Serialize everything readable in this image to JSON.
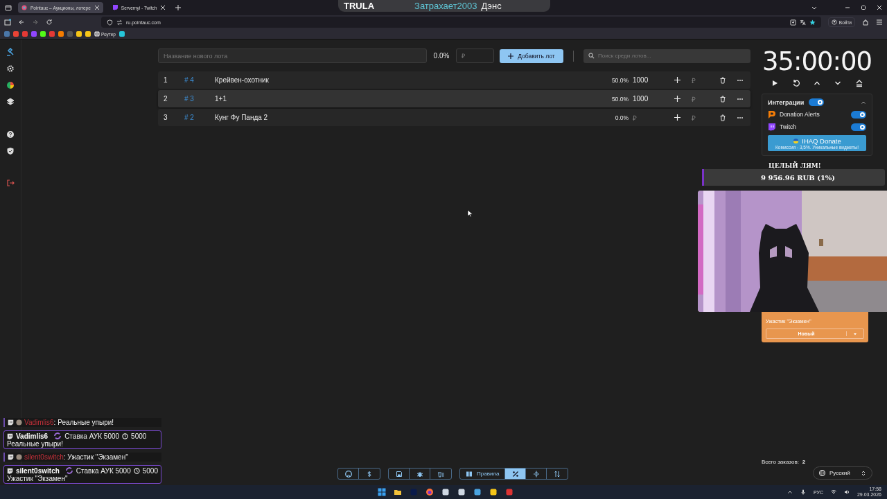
{
  "browser": {
    "tabs": [
      {
        "title": "Pointauc – Аукционы, лотере",
        "selected": true,
        "kind": "site"
      },
      {
        "title": "Servernyi - Twitch",
        "selected": false,
        "kind": "twitch"
      }
    ],
    "url": "ru.pointauc.com",
    "bookmarks": [
      {
        "kind": "icon",
        "color": "#4a76a8"
      },
      {
        "kind": "icon",
        "color": "#ea4335"
      },
      {
        "kind": "icon",
        "color": "#e53935"
      },
      {
        "kind": "icon",
        "color": "#9146ff"
      },
      {
        "kind": "icon",
        "color": "#53fc18"
      },
      {
        "kind": "icon",
        "color": "#e53935"
      },
      {
        "kind": "icon",
        "color": "#f57c00"
      },
      {
        "kind": "icon",
        "color": "#555555"
      },
      {
        "kind": "icon",
        "color": "#f5c518"
      },
      {
        "kind": "icon",
        "color": "#f5c518"
      },
      {
        "kind": "labeled",
        "label": "Роутер"
      },
      {
        "kind": "icon",
        "color": "#26c6da"
      }
    ],
    "sign_in": "Войти"
  },
  "now_playing": {
    "logo": "TRULA",
    "artist": "Затрахает2003",
    "title": "Дэнс"
  },
  "new_lot": {
    "name_placeholder": "Название нового лота",
    "percent": "0.0%",
    "amount_placeholder": "₽",
    "add_button": "Добавить лот",
    "search_placeholder": "Поиск среди лотов..."
  },
  "lots": [
    {
      "index": "1",
      "id": "# 4",
      "name": "Крейвен-охотник",
      "percent": "50.0%",
      "amount": "1000",
      "add_placeholder": "₽",
      "selected": false
    },
    {
      "index": "2",
      "id": "# 3",
      "name": "1+1",
      "percent": "50.0%",
      "amount": "1000",
      "add_placeholder": "₽",
      "selected": true
    },
    {
      "index": "3",
      "id": "# 2",
      "name": "Кунг Фу Панда 2",
      "percent": "0.0%",
      "amount_placeholder": "₽",
      "add_placeholder": "₽",
      "selected": false
    }
  ],
  "timer": {
    "time": "35:00:00"
  },
  "integrations": {
    "title": "Интеграции",
    "on": true,
    "expanded": true,
    "items": [
      {
        "kind": "donationalerts",
        "name": "Donation Alerts",
        "on": true
      },
      {
        "kind": "twitch",
        "name": "Twitch",
        "on": true
      }
    ],
    "promo": {
      "title": "IHAQ Donate",
      "subtitle": "Комиссия - 3,5%. Уникальные виджеты!"
    }
  },
  "donation_goal": {
    "title": "ЦЕЛЫЙ ЛЯМ!",
    "amount": "9 956.96 RUB (1%)",
    "level": 0.01
  },
  "order_card": {
    "text": "Ужастик \"Экзамен\"",
    "status": "Новый"
  },
  "chat": [
    {
      "kind": "plain",
      "user": "Vadimlis6",
      "separator": ":",
      "text": "Реальные упыри!"
    },
    {
      "kind": "bid",
      "user": "Vadimlis6",
      "bid": "Ставка АУК 5000",
      "points": "5000",
      "text": "Реальные упыри!"
    },
    {
      "kind": "plain",
      "user": "silent0switch",
      "separator": ":",
      "text": "Ужастик \"Экзамен\""
    },
    {
      "kind": "bid",
      "user": "silent0switch",
      "bid": "Ставка АУК 5000",
      "points": "5000",
      "text": "Ужастик \"Экзамен\""
    }
  ],
  "tool_groups": [
    [
      {
        "kind": "github",
        "selected": false
      },
      {
        "kind": "donate",
        "selected": false
      }
    ],
    [
      {
        "kind": "save",
        "selected": false
      },
      {
        "kind": "bug",
        "selected": false
      },
      {
        "kind": "clear",
        "selected": false
      }
    ],
    [
      {
        "kind": "rules",
        "label": "Правила",
        "selected": false
      },
      {
        "kind": "percent",
        "selected": true
      },
      {
        "kind": "split",
        "selected": false
      },
      {
        "kind": "sort",
        "selected": false
      }
    ]
  ],
  "orders": {
    "label": "Всего заказов:",
    "count": "2"
  },
  "language": "Русский",
  "taskbar": {
    "input_language": "РУС",
    "time": "17:58",
    "date": "29.03.2026"
  }
}
